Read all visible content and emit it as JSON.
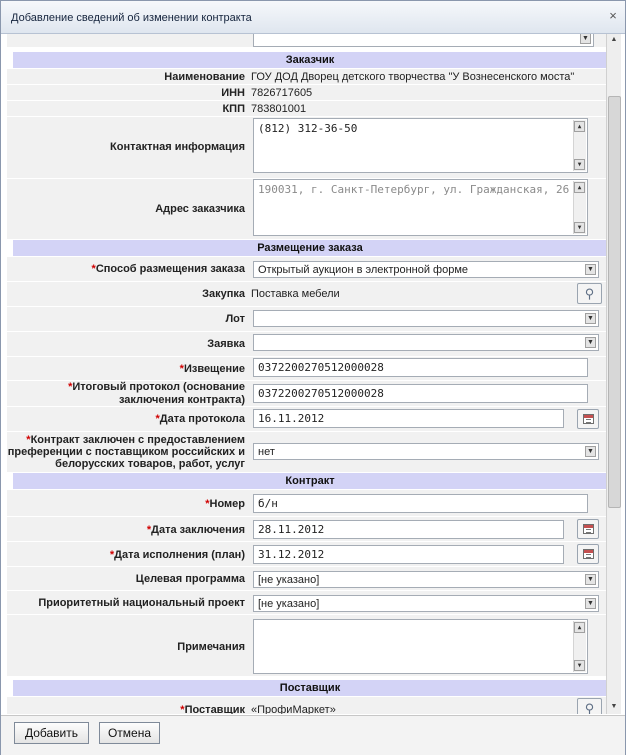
{
  "window": {
    "title": "Добавление сведений об изменении контракта"
  },
  "customer": {
    "header": "Заказчик",
    "name_label": "Наименование",
    "name_value": "ГОУ ДОД Дворец детского творчества \"У Вознесенского моста\"",
    "inn_label": "ИНН",
    "inn_value": "7826717605",
    "kpp_label": "КПП",
    "kpp_value": "783801001",
    "contact_label": "Контактная информация",
    "contact_value": "(812) 312-36-50",
    "address_label": "Адрес заказчика",
    "address_value": "190031, г. Санкт-Петербург, ул. Гражданская, 26"
  },
  "order": {
    "header": "Размещение заказа",
    "method_label": "Способ размещения заказа",
    "method_value": "Открытый аукцион в электронной форме",
    "purchase_label": "Закупка",
    "purchase_value": "Поставка мебели",
    "lot_label": "Лот",
    "lot_value": "",
    "bid_label": "Заявка",
    "bid_value": "",
    "notice_label": "Извещение",
    "notice_value": "0372200270512000028",
    "protocol_label": "Итоговый протокол (основание заключения контракта)",
    "protocol_value": "0372200270512000028",
    "protocol_date_label": "Дата протокола",
    "protocol_date_value": "16.11.2012",
    "preference_label": "Контракт заключен с предоставлением преференции с поставщиком российских и белорусских товаров, работ, услуг",
    "preference_value": "нет"
  },
  "contract": {
    "header": "Контракт",
    "number_label": "Номер",
    "number_value": "б/н",
    "sign_date_label": "Дата заключения",
    "sign_date_value": "28.11.2012",
    "exec_date_label": "Дата исполнения (план)",
    "exec_date_value": "31.12.2012",
    "program_label": "Целевая программа",
    "program_value": "[не указано]",
    "project_label": "Приоритетный национальный проект",
    "project_value": "[не указано]",
    "notes_label": "Примечания",
    "notes_value": ""
  },
  "supplier": {
    "header": "Поставщик",
    "supplier_label": "Поставщик",
    "supplier_value": "«ПрофиМаркет»"
  },
  "footer": {
    "add_label": "Добавить",
    "cancel_label": "Отмена"
  }
}
